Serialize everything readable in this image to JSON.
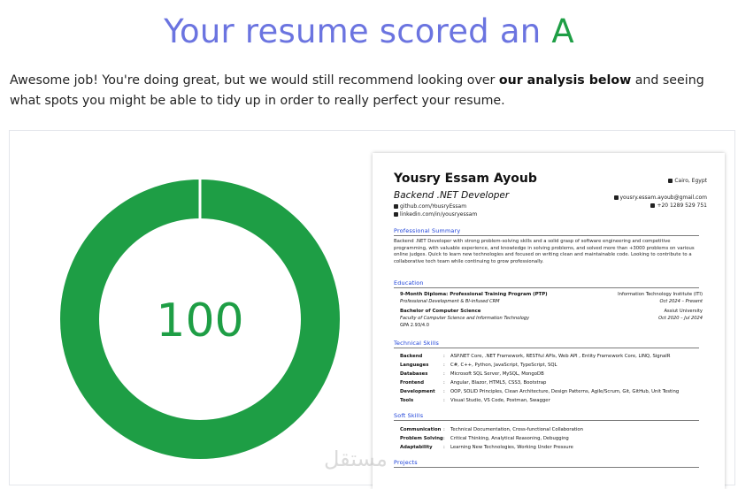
{
  "header": {
    "title_prefix": "Your resume scored an ",
    "grade": "A"
  },
  "intro": {
    "part1": "Awesome job! You're doing great, but we would still recommend looking over ",
    "bold": "our analysis below",
    "part2": " and seeing what spots you might be able to tidy up in order to really perfect your resume."
  },
  "score": {
    "value": "100",
    "fraction": 1.0,
    "color": "#1e9e45"
  },
  "resume": {
    "name": "Yousry Essam Ayoub",
    "role": "Backend .NET Developer",
    "github": "github.com/YousryEssam",
    "linkedin": "linkedin.com/in/yousryessam",
    "location": "Cairo, Egypt",
    "email": "yousry.essam.ayoub@gmail.com",
    "phone": "+20 1289 529 751",
    "sections": {
      "summary": "Professional Summary",
      "education": "Education",
      "skills": "Technical Skills",
      "soft": "Soft Skills",
      "projects": "Projects"
    },
    "summary_text": "Backend .NET Developer with strong problem-solving skills and a solid grasp of software engineering and competitive programming, with valuable experience, and knowledge in solving problems, and solved more than +3000 problems on various online judges. Quick to learn new technologies and focused on writing clean and maintainable code. Looking to contribute to a collaborative tech team while continuing to grow professionally.",
    "education": [
      {
        "title": "9-Month Diploma: Professional Training Program (PTP)",
        "subtitle": "Professional Development & BI-infused CRM",
        "institution": "Information Technology Institute (ITI)",
        "dates": "Oct 2024 – Present"
      },
      {
        "title": "Bachelor of Computer Science",
        "subtitle": "Faculty of Computer Science and Information Technology",
        "gpa": "GPA 2.93/4.0",
        "institution": "Assiut University",
        "dates": "Oct 2020 – Jul 2024"
      }
    ],
    "skills": [
      {
        "key": "Backend",
        "value": "ASP.NET Core, .NET Framework, RESTful APIs, Web API , Entity Framework Core, LINQ, SignalR"
      },
      {
        "key": "Languages",
        "value": "C#, C++, Python, JavaScript, TypeScript, SQL"
      },
      {
        "key": "Databases",
        "value": "Microsoft SQL Server, MySQL, MongoDB"
      },
      {
        "key": "Frontend",
        "value": "Angular, Blazor, HTML5, CSS3, Bootstrap"
      },
      {
        "key": "Development",
        "value": "OOP, SOLID Principles, Clean Architecture, Design Patterns, Agile/Scrum, Git, GitHub, Unit Testing"
      },
      {
        "key": "Tools",
        "value": "Visual Studio, VS Code, Postman, Swagger"
      }
    ],
    "soft_skills": [
      {
        "key": "Communication",
        "value": "Technical Documentation, Cross-functional Collaboration"
      },
      {
        "key": "Problem Solving",
        "value": "Critical Thinking, Analytical Reasoning, Debugging"
      },
      {
        "key": "Adaptability",
        "value": "Learning New Technologies, Working Under Pressure"
      }
    ]
  },
  "watermark": "مستقل"
}
